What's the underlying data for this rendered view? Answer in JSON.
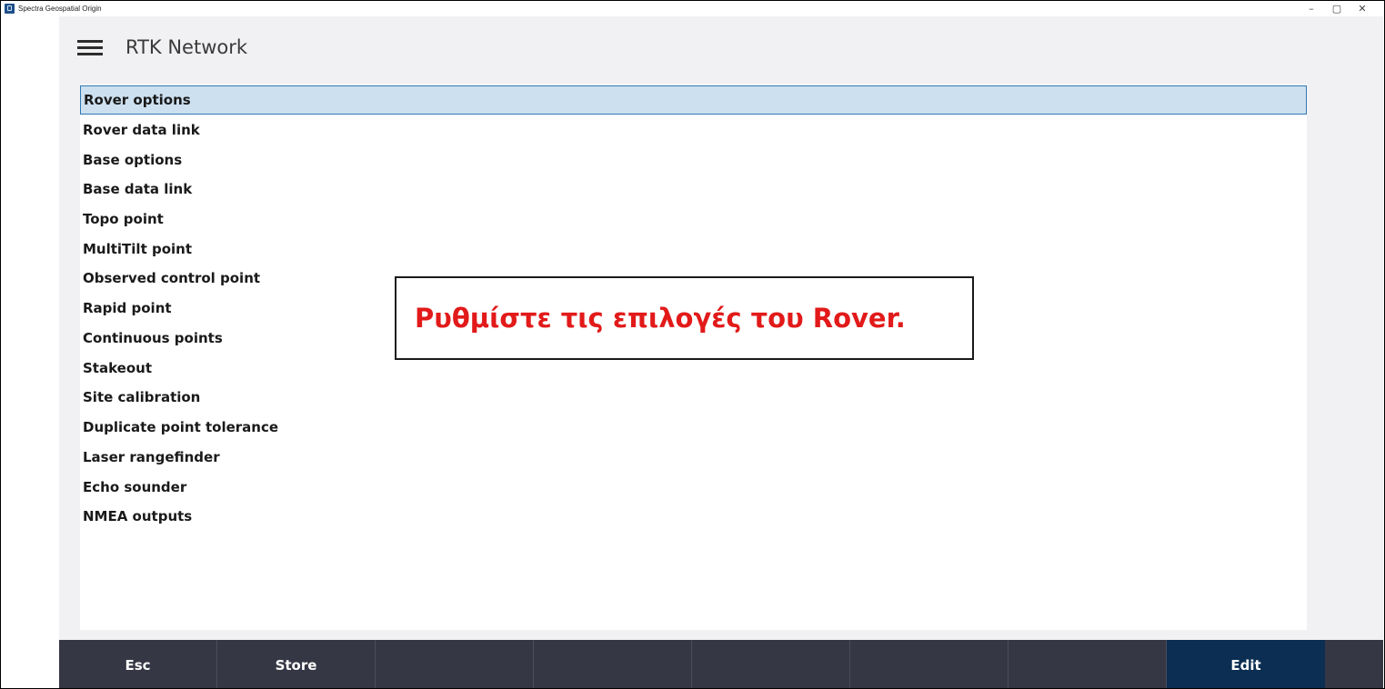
{
  "window": {
    "title": "Spectra Geospatial Origin",
    "controls": {
      "minimize": "–",
      "restore": "▢",
      "close": "✕"
    }
  },
  "header": {
    "title": "RTK Network",
    "menu_icon": "hamburger-menu-icon"
  },
  "list": {
    "selected_index": 0,
    "items": [
      "Rover options",
      "Rover data link",
      "Base options",
      "Base data link",
      "Topo point",
      "MultiTilt point",
      "Observed control point",
      "Rapid point",
      "Continuous points",
      "Stakeout",
      "Site calibration",
      "Duplicate point tolerance",
      "Laser rangefinder",
      "Echo sounder",
      "NMEA outputs"
    ]
  },
  "callout": {
    "text": "Ρυθμίστε τις επιλογές του Rover.",
    "color": "#e21a1a"
  },
  "softkeys": [
    "Esc",
    "Store",
    "",
    "",
    "",
    "",
    "",
    "Edit"
  ],
  "colors": {
    "selection_bg": "#cde0ef",
    "selection_border": "#2f78b5",
    "softkey_bar": "#363744",
    "softkey_primary": "#0b2e52"
  }
}
